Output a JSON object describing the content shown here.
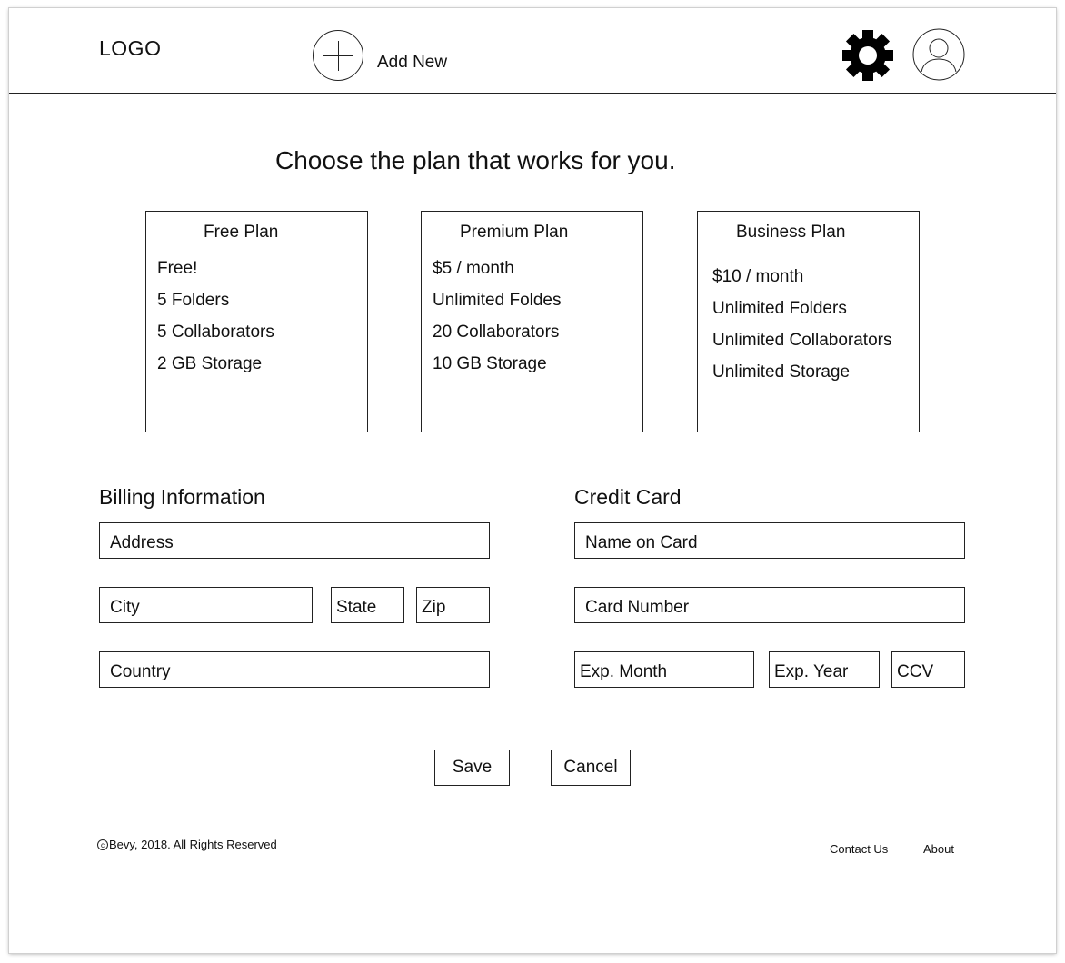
{
  "header": {
    "logo": "LOGO",
    "add_new_label": "Add New",
    "icons": [
      "plus-circle-icon",
      "gear-icon",
      "user-avatar-icon"
    ]
  },
  "main": {
    "headline": "Choose the plan that works for you.",
    "plans": [
      {
        "title": "Free Plan",
        "lines": [
          "Free!",
          "5 Folders",
          "5 Collaborators",
          "2 GB Storage"
        ]
      },
      {
        "title": "Premium Plan",
        "lines": [
          "$5 / month",
          "Unlimited Foldes",
          "20 Collaborators",
          "10 GB Storage"
        ]
      },
      {
        "title": "Business Plan",
        "lines": [
          "$10 / month",
          "Unlimited Folders",
          "Unlimited Collaborators",
          "Unlimited Storage"
        ]
      }
    ]
  },
  "billing": {
    "title": "Billing Information",
    "address_placeholder": "Address",
    "city_placeholder": "City",
    "state_placeholder": "State",
    "zip_placeholder": "Zip",
    "country_placeholder": "Country"
  },
  "card": {
    "title": "Credit Card",
    "name_placeholder": "Name on Card",
    "number_placeholder": "Card Number",
    "exp_month_placeholder": "Exp. Month",
    "exp_year_placeholder": "Exp. Year",
    "ccv_placeholder": "CCV"
  },
  "actions": {
    "save_label": "Save",
    "cancel_label": "Cancel"
  },
  "footer": {
    "copyright_symbol": "c",
    "copyright": "Bevy, 2018. All Rights Reserved",
    "links": [
      "Contact Us",
      "About"
    ]
  }
}
